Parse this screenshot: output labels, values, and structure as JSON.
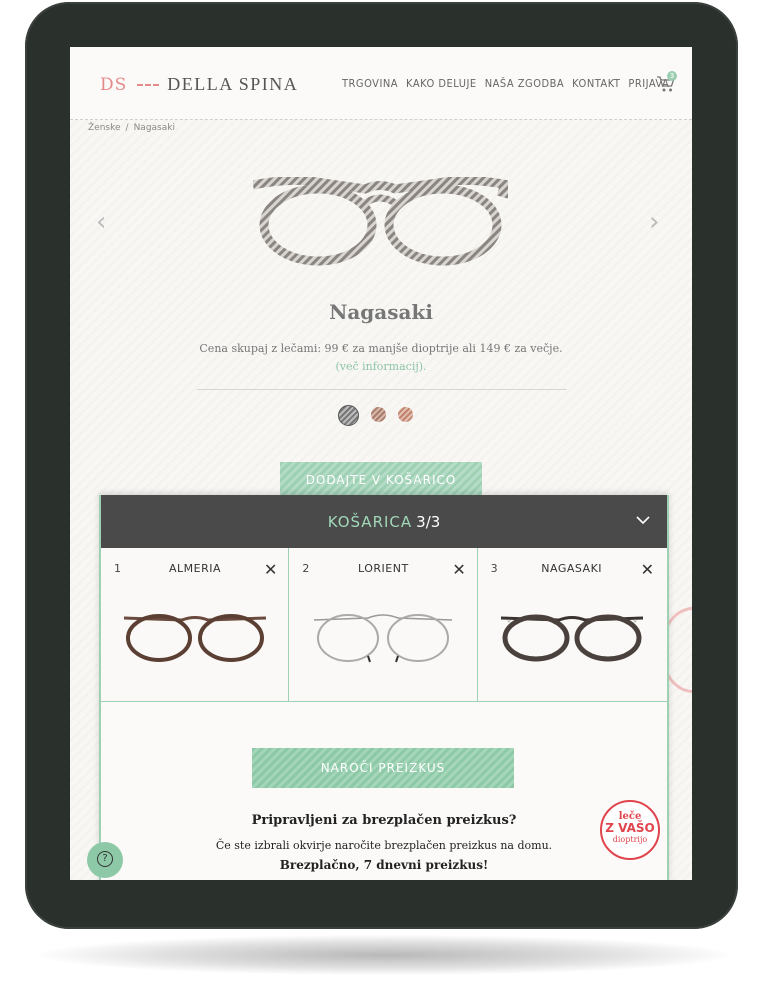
{
  "header": {
    "logo_mark": "DS",
    "logo_name": "DELLA SPINA",
    "nav": [
      "TRGOVINA",
      "KAKO DELUJE",
      "NAŠA ZGODBA",
      "KONTAKT",
      "PRIJAVA"
    ],
    "cart_badge": "3"
  },
  "breadcrumb": [
    "Ženske",
    "/",
    "Nagasaki"
  ],
  "product": {
    "name": "Nagasaki",
    "price_text": "Cena skupaj z lečami: 99 € za manjše dioptrije ali 149 € za večje.",
    "more_info": "(več informacij).",
    "add_to_cart": "DODAJTE V KOŠARICO"
  },
  "cart": {
    "title": "KOŠARICA",
    "count": "3/3",
    "items": [
      {
        "num": "1",
        "name": "ALMERIA",
        "remove": "✕"
      },
      {
        "num": "2",
        "name": "LORIENT",
        "remove": "✕"
      },
      {
        "num": "3",
        "name": "NAGASAKI",
        "remove": "✕"
      }
    ],
    "order_button": "NAROČI PREIZKUS",
    "ready_heading": "Pripravljeni za brezplačen preizkus?",
    "description": "Če ste izbrali okvirje naročite brezplačen preizkus na domu.",
    "free_trial": "Brezplačno, 7 dnevni preizkus!",
    "stamp": {
      "line1": "leče",
      "line2": "Z VAŠO",
      "line3": "dioptrijo"
    }
  },
  "help": "?",
  "colors": {
    "accent": "#9ed0b4",
    "panel_header": "#4a4a4a",
    "stamp": "#e0444c",
    "logo": "#e58a8a"
  }
}
